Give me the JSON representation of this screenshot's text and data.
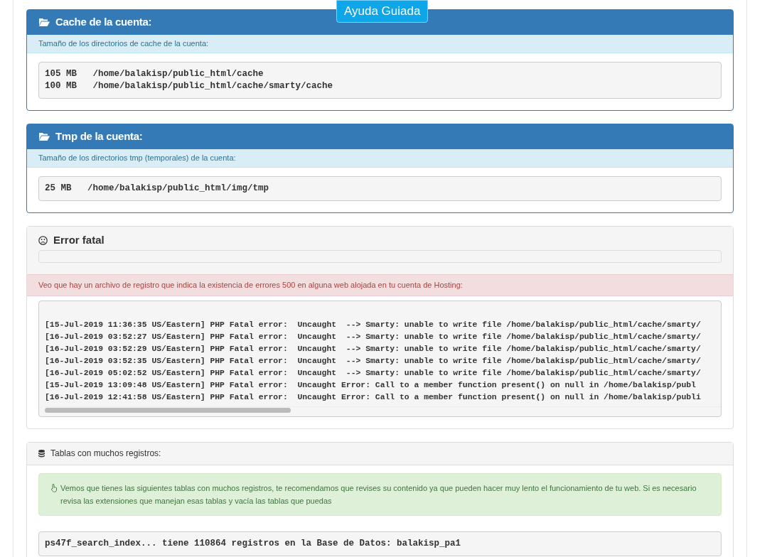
{
  "help_button": "Ayuda Guiada",
  "cache_panel": {
    "title": "Cache de la cuenta:",
    "subtitle": "Tamaño de los directorios de cache de la cuenta:",
    "lines": [
      "105 MB   /home/balakisp/public_html/cache",
      "100 MB   /home/balakisp/public_html/cache/smarty/cache"
    ]
  },
  "tmp_panel": {
    "title": "Tmp de la cuenta:",
    "subtitle": "Tamaño de los directorios tmp (temporales) de la cuenta:",
    "lines": [
      "25 MB   /home/balakisp/public_html/img/tmp"
    ]
  },
  "error_panel": {
    "title": "Error fatal",
    "alert": "Veo que hay un archivo de registro que indica la existencia de errores 500 en alguna web alojada en tu cuenta de Hosting:",
    "log_lines": [
      "[15-Jul-2019 11:36:35 US/Eastern] PHP Fatal error:  Uncaught  --> Smarty: unable to write file /home/balakisp/public_html/cache/smarty/",
      "[16-Jul-2019 03:52:27 US/Eastern] PHP Fatal error:  Uncaught  --> Smarty: unable to write file /home/balakisp/public_html/cache/smarty/",
      "[16-Jul-2019 03:52:29 US/Eastern] PHP Fatal error:  Uncaught  --> Smarty: unable to write file /home/balakisp/public_html/cache/smarty/",
      "[16-Jul-2019 03:52:35 US/Eastern] PHP Fatal error:  Uncaught  --> Smarty: unable to write file /home/balakisp/public_html/cache/smarty/",
      "[16-Jul-2019 05:02:52 US/Eastern] PHP Fatal error:  Uncaught  --> Smarty: unable to write file /home/balakisp/public_html/cache/smarty/",
      "[15-Jul-2019 13:09:48 US/Eastern] PHP Fatal error:  Uncaught Error: Call to a member function present() on null in /home/balakisp/publ",
      "[16-Jul-2019 12:41:58 US/Eastern] PHP Fatal error:  Uncaught Error: Call to a member function present() on null in /home/balakisp/publi"
    ]
  },
  "tables_panel": {
    "title": "Tablas con muchos registros:",
    "notice": "Vemos que tienes las siguientes tablas con muchos registros, te recomendamos que revises su contenido ya que pueden hacer muy lento el funcionamiento de tu web. Si es necesario revisa las extensiones que manejan esas tablas y vacía las tablas que puedas",
    "lines": [
      "ps47f_search_index... tiene 110864 registros en la Base de Datos: balakisp_pa1"
    ]
  }
}
